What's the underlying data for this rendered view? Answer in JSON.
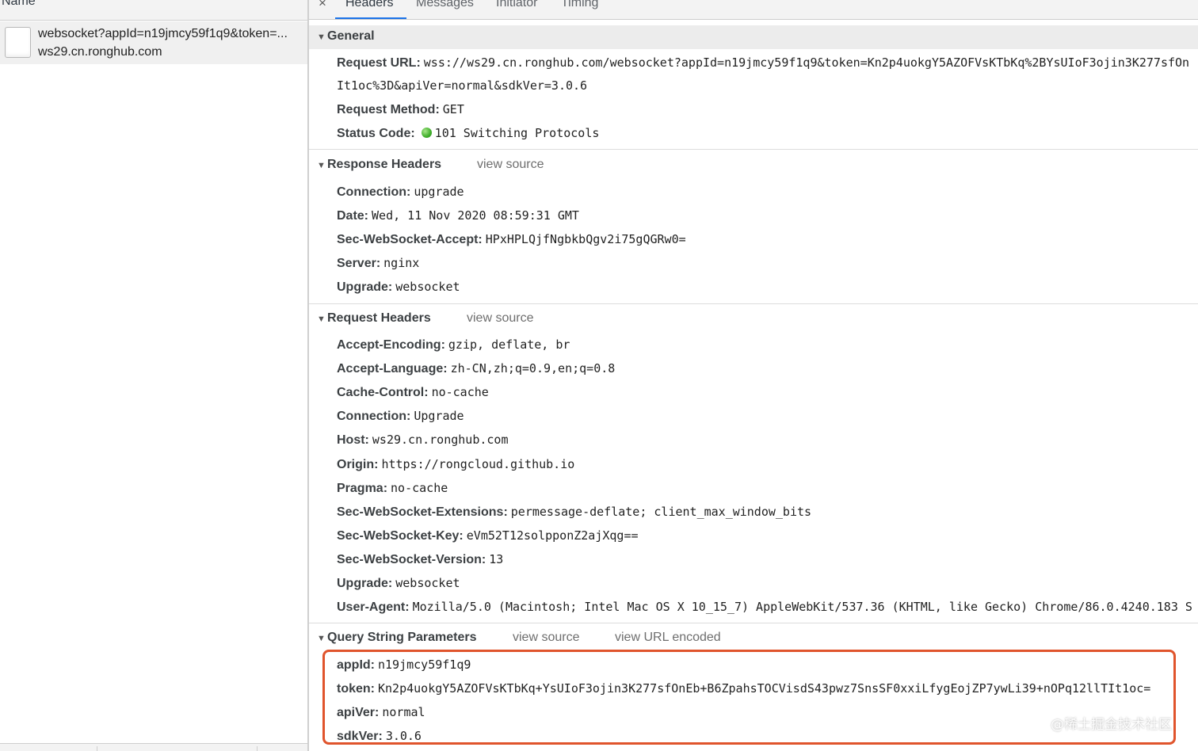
{
  "request_list": {
    "column_header": "Name",
    "request": {
      "name": "websocket?appId=n19jmcy59f1q9&token=...",
      "host": "ws29.cn.ronghub.com"
    }
  },
  "tabs": {
    "close_icon": "×",
    "items": [
      "Headers",
      "Messages",
      "Initiator",
      "Timing"
    ],
    "active": "Headers"
  },
  "general": {
    "title": "General",
    "request_url_label": "Request URL:",
    "request_url_line1": "wss://ws29.cn.ronghub.com/websocket?appId=n19jmcy59f1q9&token=Kn2p4uokgY5AZOFVsKTbKq%2BYsUIoF3ojin3K277sfOn",
    "request_url_line2": "It1oc%3D&apiVer=normal&sdkVer=3.0.6",
    "request_method_label": "Request Method:",
    "request_method": "GET",
    "status_code_label": "Status Code:",
    "status_code": "101 Switching Protocols",
    "status_color": "#3fae2a"
  },
  "response_headers": {
    "title": "Response Headers",
    "view_source": "view source",
    "items": [
      {
        "key": "Connection:",
        "value": "upgrade"
      },
      {
        "key": "Date:",
        "value": "Wed, 11 Nov 2020 08:59:31 GMT"
      },
      {
        "key": "Sec-WebSocket-Accept:",
        "value": "HPxHPLQjfNgbkbQgv2i75gQGRw0="
      },
      {
        "key": "Server:",
        "value": "nginx"
      },
      {
        "key": "Upgrade:",
        "value": "websocket"
      }
    ]
  },
  "request_headers": {
    "title": "Request Headers",
    "view_source": "view source",
    "items": [
      {
        "key": "Accept-Encoding:",
        "value": "gzip, deflate, br"
      },
      {
        "key": "Accept-Language:",
        "value": "zh-CN,zh;q=0.9,en;q=0.8"
      },
      {
        "key": "Cache-Control:",
        "value": "no-cache"
      },
      {
        "key": "Connection:",
        "value": "Upgrade"
      },
      {
        "key": "Host:",
        "value": "ws29.cn.ronghub.com"
      },
      {
        "key": "Origin:",
        "value": "https://rongcloud.github.io"
      },
      {
        "key": "Pragma:",
        "value": "no-cache"
      },
      {
        "key": "Sec-WebSocket-Extensions:",
        "value": "permessage-deflate; client_max_window_bits"
      },
      {
        "key": "Sec-WebSocket-Key:",
        "value": "eVm52T12solpponZ2ajXqg=="
      },
      {
        "key": "Sec-WebSocket-Version:",
        "value": "13"
      },
      {
        "key": "Upgrade:",
        "value": "websocket"
      },
      {
        "key": "User-Agent:",
        "value": "Mozilla/5.0 (Macintosh; Intel Mac OS X 10_15_7) AppleWebKit/537.36 (KHTML, like Gecko) Chrome/86.0.4240.183 S"
      }
    ]
  },
  "query_params": {
    "title": "Query String Parameters",
    "view_source": "view source",
    "view_url_encoded": "view URL encoded",
    "items": [
      {
        "key": "appId:",
        "value": "n19jmcy59f1q9"
      },
      {
        "key": "token:",
        "value": "Kn2p4uokgY5AZOFVsKTbKq+YsUIoF3ojin3K277sfOnEb+B6ZpahsTOCVisdS43pwz7SnsSF0xxiLfygEojZP7ywLi39+nOPq12llTIt1oc="
      },
      {
        "key": "apiVer:",
        "value": "normal"
      },
      {
        "key": "sdkVer:",
        "value": "3.0.6"
      }
    ],
    "highlight_color": "#e0542c"
  },
  "watermark": "@稀土掘金技术社区"
}
